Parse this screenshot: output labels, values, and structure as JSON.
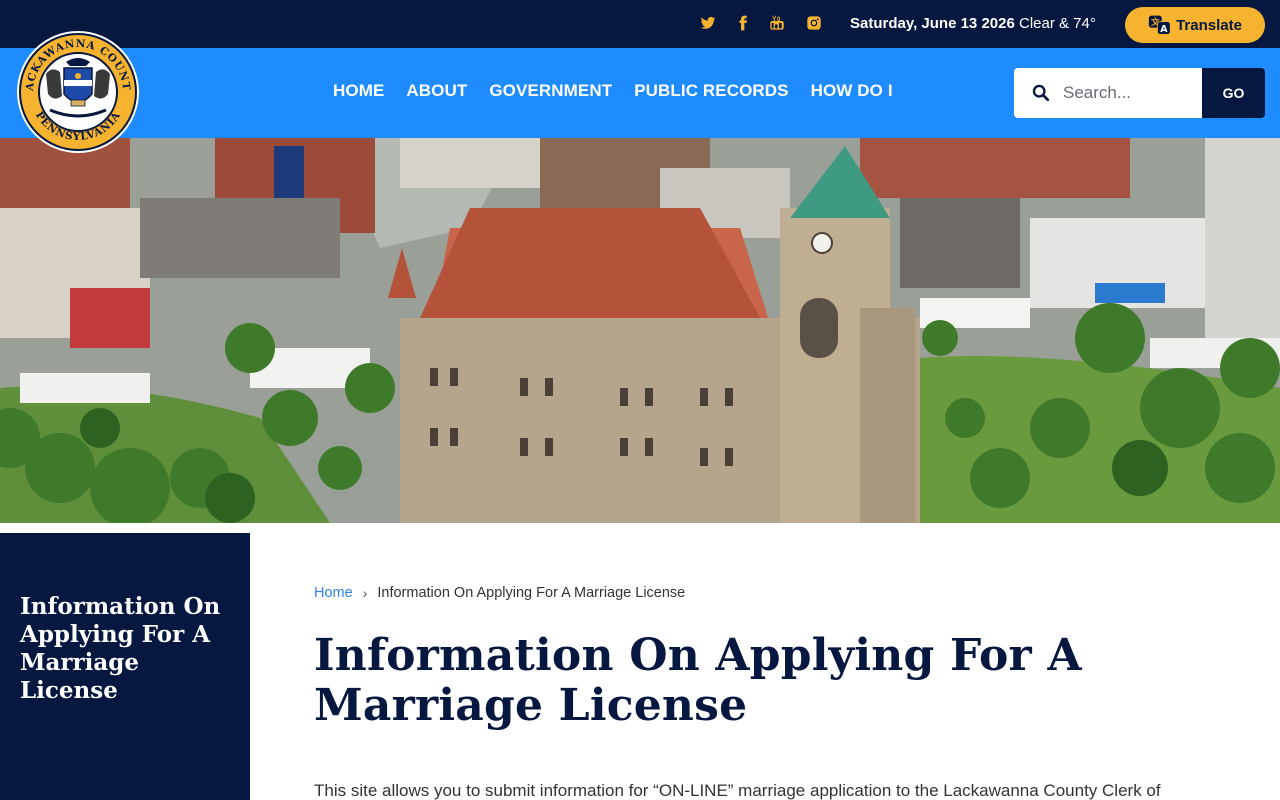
{
  "topbar": {
    "social": [
      {
        "name": "twitter-icon"
      },
      {
        "name": "facebook-icon"
      },
      {
        "name": "youtube-icon"
      },
      {
        "name": "instagram-icon"
      }
    ],
    "date": "Saturday, June 13 2026",
    "weather": "Clear & 74°",
    "translate_label": "Translate"
  },
  "seal": {
    "top_text": "LACKAWANNA COUNTY",
    "bottom_text": "PENNSYLVANIA"
  },
  "nav": {
    "items": [
      "HOME",
      "ABOUT",
      "GOVERNMENT",
      "PUBLIC RECORDS",
      "HOW DO I"
    ]
  },
  "search": {
    "placeholder": "Search...",
    "button_label": "GO"
  },
  "sidebar": {
    "title": "Information On Applying For A Marriage License"
  },
  "breadcrumb": {
    "home": "Home",
    "separator": "›",
    "current": "Information On Applying For A Marriage License"
  },
  "page": {
    "title": "Information On Applying For A Marriage License",
    "intro": "This site allows you to submit information for “ON-LINE” marriage application to the Lackawanna County Clerk of"
  },
  "colors": {
    "navy": "#061740",
    "blue": "#1e8bff",
    "gold": "#f6b330",
    "link": "#2d84e8"
  }
}
